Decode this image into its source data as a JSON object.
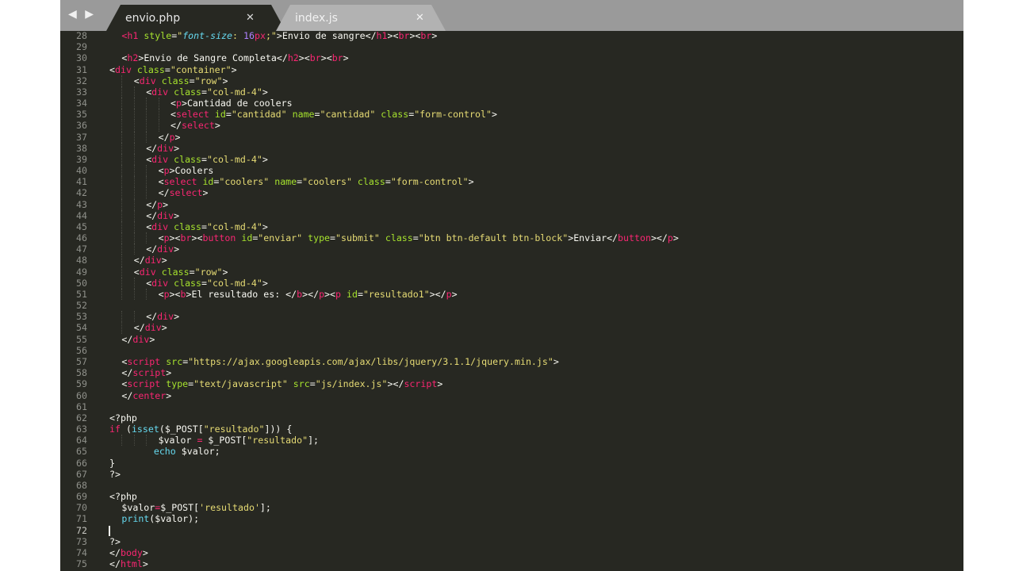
{
  "editor": {
    "nav_arrows": "◀ ▶",
    "tabs": [
      {
        "label": "envio.php",
        "active": true
      },
      {
        "label": "index.js",
        "active": false
      }
    ],
    "close_glyph": "✕",
    "active_line": 72
  },
  "code": [
    {
      "n": 28,
      "ind": 1,
      "c": [
        [
          "t",
          "<h1"
        ],
        [
          "a",
          " style"
        ],
        [
          "",
          "="
        ],
        [
          "s",
          "\""
        ],
        [
          "i",
          "font-size"
        ],
        [
          "s",
          ": "
        ],
        [
          "n",
          "16"
        ],
        [
          "t",
          "px"
        ],
        [
          "s",
          ";\""
        ],
        [
          "",
          ">Envio de sangre</"
        ],
        [
          "t",
          "h1"
        ],
        [
          "",
          "><"
        ],
        [
          "t",
          "br"
        ],
        [
          "",
          "><"
        ],
        [
          "t",
          "br"
        ],
        [
          "",
          ">"
        ]
      ]
    },
    {
      "n": 29,
      "ind": 0,
      "c": []
    },
    {
      "n": 30,
      "ind": 1,
      "c": [
        [
          "",
          "<"
        ],
        [
          "t",
          "h2"
        ],
        [
          "",
          ">Envio de Sangre Completa</"
        ],
        [
          "t",
          "h2"
        ],
        [
          "",
          "><"
        ],
        [
          "t",
          "br"
        ],
        [
          "",
          "><"
        ],
        [
          "t",
          "br"
        ],
        [
          "",
          ">"
        ]
      ]
    },
    {
      "n": 31,
      "ind": 0,
      "c": [
        [
          "",
          "<"
        ],
        [
          "t",
          "div"
        ],
        [
          "a",
          " class"
        ],
        [
          "",
          "="
        ],
        [
          "s",
          "\"container\""
        ],
        [
          "",
          ">"
        ]
      ]
    },
    {
      "n": 32,
      "ind": 2,
      "c": [
        [
          "",
          "<"
        ],
        [
          "t",
          "div"
        ],
        [
          "a",
          " class"
        ],
        [
          "",
          "="
        ],
        [
          "s",
          "\"row\""
        ],
        [
          "",
          ">"
        ]
      ]
    },
    {
      "n": 33,
      "ind": 3,
      "c": [
        [
          "",
          "<"
        ],
        [
          "t",
          "div"
        ],
        [
          "a",
          " class"
        ],
        [
          "",
          "="
        ],
        [
          "s",
          "\"col-md-4\""
        ],
        [
          "",
          ">"
        ]
      ]
    },
    {
      "n": 34,
      "ind": 5,
      "c": [
        [
          "",
          "<"
        ],
        [
          "t",
          "p"
        ],
        [
          "",
          ">Cantidad de coolers"
        ]
      ]
    },
    {
      "n": 35,
      "ind": 5,
      "c": [
        [
          "",
          "<"
        ],
        [
          "t",
          "select"
        ],
        [
          "a",
          " id"
        ],
        [
          "",
          "="
        ],
        [
          "s",
          "\"cantidad\""
        ],
        [
          "a",
          " name"
        ],
        [
          "",
          "="
        ],
        [
          "s",
          "\"cantidad\""
        ],
        [
          "a",
          " class"
        ],
        [
          "",
          "="
        ],
        [
          "s",
          "\"form-control\""
        ],
        [
          "",
          ">"
        ]
      ]
    },
    {
      "n": 36,
      "ind": 5,
      "c": [
        [
          "",
          "</"
        ],
        [
          "t",
          "select"
        ],
        [
          "",
          ">"
        ]
      ]
    },
    {
      "n": 37,
      "ind": 4,
      "c": [
        [
          "",
          "</"
        ],
        [
          "t",
          "p"
        ],
        [
          "",
          ">"
        ]
      ]
    },
    {
      "n": 38,
      "ind": 3,
      "c": [
        [
          "",
          "</"
        ],
        [
          "t",
          "div"
        ],
        [
          "",
          ">"
        ]
      ]
    },
    {
      "n": 39,
      "ind": 3,
      "c": [
        [
          "",
          "<"
        ],
        [
          "t",
          "div"
        ],
        [
          "a",
          " class"
        ],
        [
          "",
          "="
        ],
        [
          "s",
          "\"col-md-4\""
        ],
        [
          "",
          ">"
        ]
      ]
    },
    {
      "n": 40,
      "ind": 4,
      "c": [
        [
          "",
          "<"
        ],
        [
          "t",
          "p"
        ],
        [
          "",
          ">Coolers"
        ]
      ]
    },
    {
      "n": 41,
      "ind": 4,
      "c": [
        [
          "",
          "<"
        ],
        [
          "t",
          "select"
        ],
        [
          "a",
          " id"
        ],
        [
          "",
          "="
        ],
        [
          "s",
          "\"coolers\""
        ],
        [
          "a",
          " name"
        ],
        [
          "",
          "="
        ],
        [
          "s",
          "\"coolers\""
        ],
        [
          "a",
          " class"
        ],
        [
          "",
          "="
        ],
        [
          "s",
          "\"form-control\""
        ],
        [
          "",
          ">"
        ]
      ]
    },
    {
      "n": 42,
      "ind": 4,
      "c": [
        [
          "",
          "</"
        ],
        [
          "t",
          "select"
        ],
        [
          "",
          ">"
        ]
      ]
    },
    {
      "n": 43,
      "ind": 3,
      "c": [
        [
          "",
          "</"
        ],
        [
          "t",
          "p"
        ],
        [
          "",
          ">"
        ]
      ]
    },
    {
      "n": 44,
      "ind": 3,
      "c": [
        [
          "",
          "</"
        ],
        [
          "t",
          "div"
        ],
        [
          "",
          ">"
        ]
      ]
    },
    {
      "n": 45,
      "ind": 3,
      "c": [
        [
          "",
          "<"
        ],
        [
          "t",
          "div"
        ],
        [
          "a",
          " class"
        ],
        [
          "",
          "="
        ],
        [
          "s",
          "\"col-md-4\""
        ],
        [
          "",
          ">"
        ]
      ]
    },
    {
      "n": 46,
      "ind": 4,
      "c": [
        [
          "",
          "<"
        ],
        [
          "t",
          "p"
        ],
        [
          "",
          "><"
        ],
        [
          "t",
          "br"
        ],
        [
          "",
          "><"
        ],
        [
          "t",
          "button"
        ],
        [
          "a",
          " id"
        ],
        [
          "",
          "="
        ],
        [
          "s",
          "\"enviar\""
        ],
        [
          "a",
          " type"
        ],
        [
          "",
          "="
        ],
        [
          "s",
          "\"submit\""
        ],
        [
          "a",
          " class"
        ],
        [
          "",
          "="
        ],
        [
          "s",
          "\"btn btn-default btn-block\""
        ],
        [
          "",
          ">Enviar</"
        ],
        [
          "t",
          "button"
        ],
        [
          "",
          "></"
        ],
        [
          "t",
          "p"
        ],
        [
          "",
          ">"
        ]
      ]
    },
    {
      "n": 47,
      "ind": 3,
      "c": [
        [
          "",
          "</"
        ],
        [
          "t",
          "div"
        ],
        [
          "",
          ">"
        ]
      ]
    },
    {
      "n": 48,
      "ind": 2,
      "c": [
        [
          "",
          "</"
        ],
        [
          "t",
          "div"
        ],
        [
          "",
          ">"
        ]
      ]
    },
    {
      "n": 49,
      "ind": 2,
      "c": [
        [
          "",
          "<"
        ],
        [
          "t",
          "div"
        ],
        [
          "a",
          " class"
        ],
        [
          "",
          "="
        ],
        [
          "s",
          "\"row\""
        ],
        [
          "",
          ">"
        ]
      ]
    },
    {
      "n": 50,
      "ind": 3,
      "c": [
        [
          "",
          "<"
        ],
        [
          "t",
          "div"
        ],
        [
          "a",
          " class"
        ],
        [
          "",
          "="
        ],
        [
          "s",
          "\"col-md-4\""
        ],
        [
          "",
          ">"
        ]
      ]
    },
    {
      "n": 51,
      "ind": 4,
      "c": [
        [
          "",
          "<"
        ],
        [
          "t",
          "p"
        ],
        [
          "",
          "><"
        ],
        [
          "t",
          "b"
        ],
        [
          "",
          ">El resultado es: </"
        ],
        [
          "t",
          "b"
        ],
        [
          "",
          "></"
        ],
        [
          "t",
          "p"
        ],
        [
          "",
          "><"
        ],
        [
          "t",
          "p"
        ],
        [
          "a",
          " id"
        ],
        [
          "",
          "="
        ],
        [
          "s",
          "\"resultado1\""
        ],
        [
          "",
          "></"
        ],
        [
          "t",
          "p"
        ],
        [
          "",
          ">"
        ]
      ]
    },
    {
      "n": 52,
      "ind": 0,
      "c": []
    },
    {
      "n": 53,
      "ind": 3,
      "c": [
        [
          "",
          "</"
        ],
        [
          "t",
          "div"
        ],
        [
          "",
          ">"
        ]
      ]
    },
    {
      "n": 54,
      "ind": 2,
      "c": [
        [
          "",
          "</"
        ],
        [
          "t",
          "div"
        ],
        [
          "",
          ">"
        ]
      ]
    },
    {
      "n": 55,
      "ind": 1,
      "c": [
        [
          "",
          "</"
        ],
        [
          "t",
          "div"
        ],
        [
          "",
          ">"
        ]
      ]
    },
    {
      "n": 56,
      "ind": 0,
      "c": []
    },
    {
      "n": 57,
      "ind": 1,
      "c": [
        [
          "",
          "<"
        ],
        [
          "t",
          "script"
        ],
        [
          "a",
          " src"
        ],
        [
          "",
          "="
        ],
        [
          "s",
          "\"https://ajax.googleapis.com/ajax/libs/jquery/3.1.1/jquery.min.js\""
        ],
        [
          "",
          ">"
        ]
      ]
    },
    {
      "n": 58,
      "ind": 1,
      "c": [
        [
          "",
          "</"
        ],
        [
          "t",
          "script"
        ],
        [
          "",
          ">"
        ]
      ]
    },
    {
      "n": 59,
      "ind": 1,
      "c": [
        [
          "",
          "<"
        ],
        [
          "t",
          "script"
        ],
        [
          "a",
          " type"
        ],
        [
          "",
          "="
        ],
        [
          "s",
          "\"text/javascript\""
        ],
        [
          "a",
          " src"
        ],
        [
          "",
          "="
        ],
        [
          "s",
          "\"js/index.js\""
        ],
        [
          "",
          "></"
        ],
        [
          "t",
          "script"
        ],
        [
          "",
          ">"
        ]
      ]
    },
    {
      "n": 60,
      "ind": 1,
      "c": [
        [
          "",
          "</"
        ],
        [
          "t",
          "center"
        ],
        [
          "",
          ">"
        ]
      ]
    },
    {
      "n": 61,
      "ind": 0,
      "c": []
    },
    {
      "n": 62,
      "ind": 0,
      "c": [
        [
          "",
          "<?php"
        ]
      ]
    },
    {
      "n": 63,
      "ind": 0,
      "c": [
        [
          "kw",
          "if"
        ],
        [
          "",
          " ("
        ],
        [
          "k",
          "isset"
        ],
        [
          "",
          "($_POST["
        ],
        [
          "s",
          "\"resultado\""
        ],
        [
          "",
          "])) {"
        ]
      ]
    },
    {
      "n": 64,
      "ind": 4,
      "c": [
        [
          "",
          "$valor "
        ],
        [
          "kw",
          "="
        ],
        [
          "",
          " $_POST["
        ],
        [
          "s",
          "\"resultado\""
        ],
        [
          "",
          "];"
        ]
      ]
    },
    {
      "n": 65,
      "ind": 0,
      "c": [
        [
          "",
          "        "
        ],
        [
          "k",
          "echo"
        ],
        [
          "",
          " $valor;"
        ]
      ]
    },
    {
      "n": 66,
      "ind": 0,
      "c": [
        [
          "",
          "}"
        ]
      ]
    },
    {
      "n": 67,
      "ind": 0,
      "c": [
        [
          "",
          "?>"
        ]
      ]
    },
    {
      "n": 68,
      "ind": 0,
      "c": []
    },
    {
      "n": 69,
      "ind": 0,
      "c": [
        [
          "",
          "<?php"
        ]
      ]
    },
    {
      "n": 70,
      "ind": 1,
      "c": [
        [
          "",
          "$valor"
        ],
        [
          "kw",
          "="
        ],
        [
          "",
          "$_POST["
        ],
        [
          "s",
          "'resultado'"
        ],
        [
          "",
          "];"
        ]
      ]
    },
    {
      "n": 71,
      "ind": 1,
      "c": [
        [
          "k",
          "print"
        ],
        [
          "",
          "($valor);"
        ]
      ]
    },
    {
      "n": 72,
      "ind": 0,
      "c": []
    },
    {
      "n": 73,
      "ind": 0,
      "c": [
        [
          "",
          "?>"
        ]
      ]
    },
    {
      "n": 74,
      "ind": 0,
      "c": [
        [
          "",
          "</"
        ],
        [
          "t",
          "body"
        ],
        [
          "",
          ">"
        ]
      ]
    },
    {
      "n": 75,
      "ind": 0,
      "c": [
        [
          "",
          "</"
        ],
        [
          "t",
          "html"
        ],
        [
          "",
          ">"
        ]
      ]
    }
  ]
}
